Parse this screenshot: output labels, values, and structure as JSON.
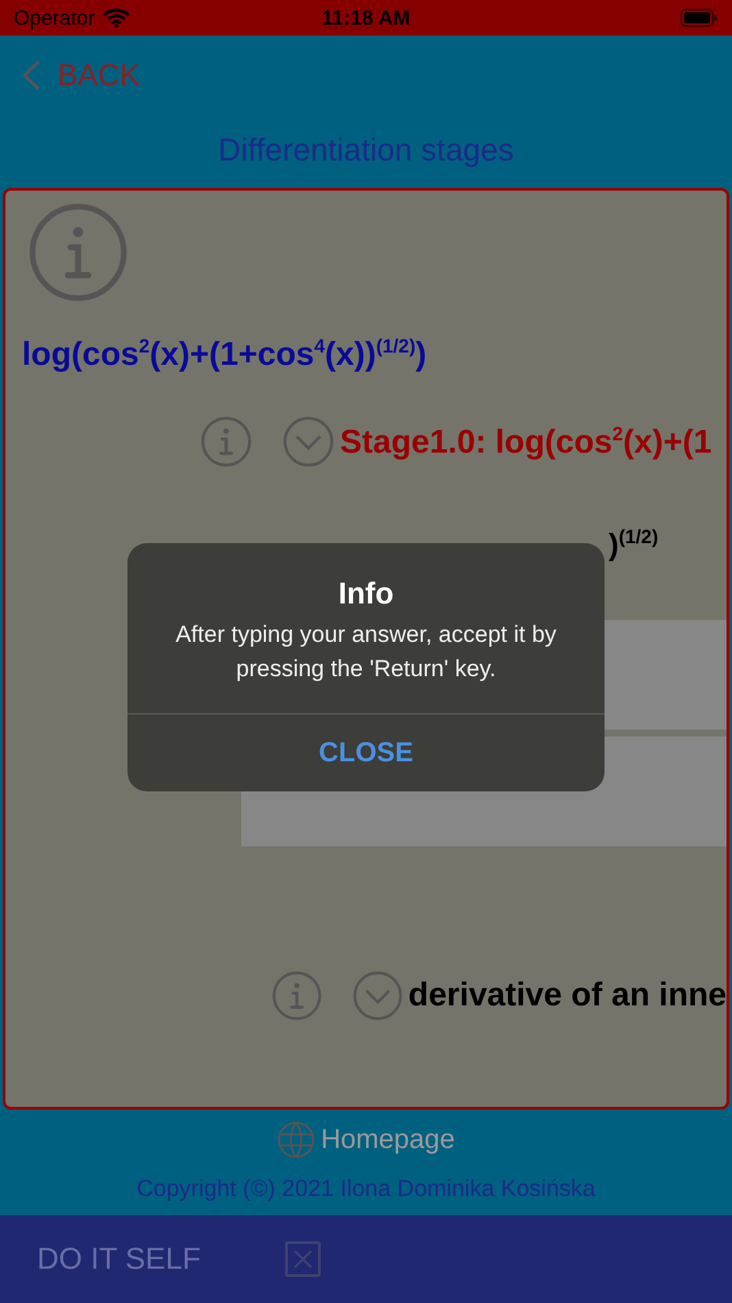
{
  "status_bar": {
    "carrier": "Operator",
    "time": "11:18 AM"
  },
  "nav": {
    "back": "BACK",
    "title": "Differentiation stages"
  },
  "card": {
    "formula": "log(cos$^{2}$(x)+(1+cos$^{4}$(x))$^{(1/2)}$)",
    "stages": [
      {
        "kind": "stage",
        "text": "Stage1.0: log(cos$^{2}$(x)+(1"
      },
      {
        "kind": "fragment",
        "text": ")$^{(1/2)}$"
      },
      {
        "kind": "input"
      },
      {
        "kind": "input"
      },
      {
        "kind": "hint",
        "text": "derivative of an inne"
      }
    ]
  },
  "footer": {
    "homepage": "Homepage",
    "copyright": "Copyright (©) 2021 Ilona Dominika Kosińska"
  },
  "bottom_bar": {
    "label": "DO IT SELF",
    "checked": false
  },
  "alert": {
    "title": "Info",
    "message": "After typing your answer, accept it by pressing the 'Return' key.",
    "button": "CLOSE"
  }
}
